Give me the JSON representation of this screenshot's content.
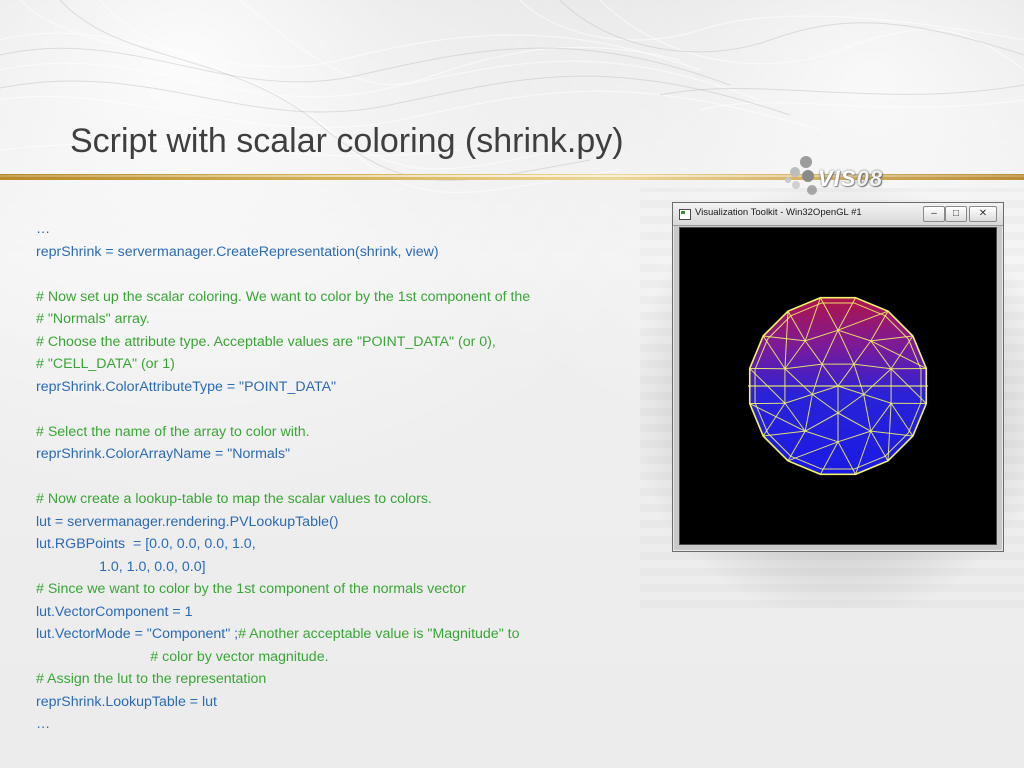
{
  "slide": {
    "title": "Script with scalar coloring (shrink.py)",
    "logo_text": "VIS",
    "logo_year": "08"
  },
  "code_lines": [
    {
      "text": "…",
      "type": "code"
    },
    {
      "text": "reprShrink = servermanager.CreateRepresentation(shrink, view)",
      "type": "code"
    },
    {
      "text": "",
      "type": "code"
    },
    {
      "text": "# Now set up the scalar coloring. We want to color by the 1st component of the",
      "type": "comment"
    },
    {
      "text": "# \"Normals\" array.",
      "type": "comment"
    },
    {
      "text": "# Choose the attribute type. Acceptable values are \"POINT_DATA\" (or 0),",
      "type": "comment"
    },
    {
      "text": "# \"CELL_DATA\" (or 1)",
      "type": "comment"
    },
    {
      "text": "reprShrink.ColorAttributeType = \"POINT_DATA\"",
      "type": "code"
    },
    {
      "text": "",
      "type": "code"
    },
    {
      "text": "# Select the name of the array to color with.",
      "type": "comment"
    },
    {
      "text": "reprShrink.ColorArrayName = \"Normals\"",
      "type": "code"
    },
    {
      "text": "",
      "type": "code"
    },
    {
      "text": "# Now create a lookup-table to map the scalar values to colors.",
      "type": "comment"
    },
    {
      "text": "lut = servermanager.rendering.PVLookupTable()",
      "type": "code"
    },
    {
      "text": "lut.RGBPoints  = [0.0, 0.0, 0.0, 1.0,",
      "type": "code"
    },
    {
      "text": "                1.0, 1.0, 0.0, 0.0]",
      "type": "code"
    },
    {
      "text": "# Since we want to color by the 1st component of the normals vector",
      "type": "comment"
    },
    {
      "text": "lut.VectorComponent = 1",
      "type": "code"
    },
    {
      "text": "lut.VectorMode = \"Component\" ;",
      "suffix": "# Another acceptable value is \"Magnitude\" to",
      "type": "mixed"
    },
    {
      "text": "                             # color by vector magnitude.",
      "type": "comment"
    },
    {
      "text": "# Assign the lut to the representation",
      "type": "comment"
    },
    {
      "text": "reprShrink.LookupTable = lut",
      "type": "code"
    },
    {
      "text": "…",
      "type": "code"
    }
  ],
  "window": {
    "title": "Visualization Toolkit - Win32OpenGL #1",
    "minimize_glyph": "–",
    "maximize_glyph": "□",
    "close_glyph": "✕",
    "icon": "window-app-icon"
  },
  "colors": {
    "code": "#2b6ab5",
    "comment": "#3aa537",
    "title": "#3f3f3f",
    "mesh_top": "#b0154a",
    "mesh_bottom": "#1a1ae6",
    "mesh_lines": "#f2f26a"
  }
}
